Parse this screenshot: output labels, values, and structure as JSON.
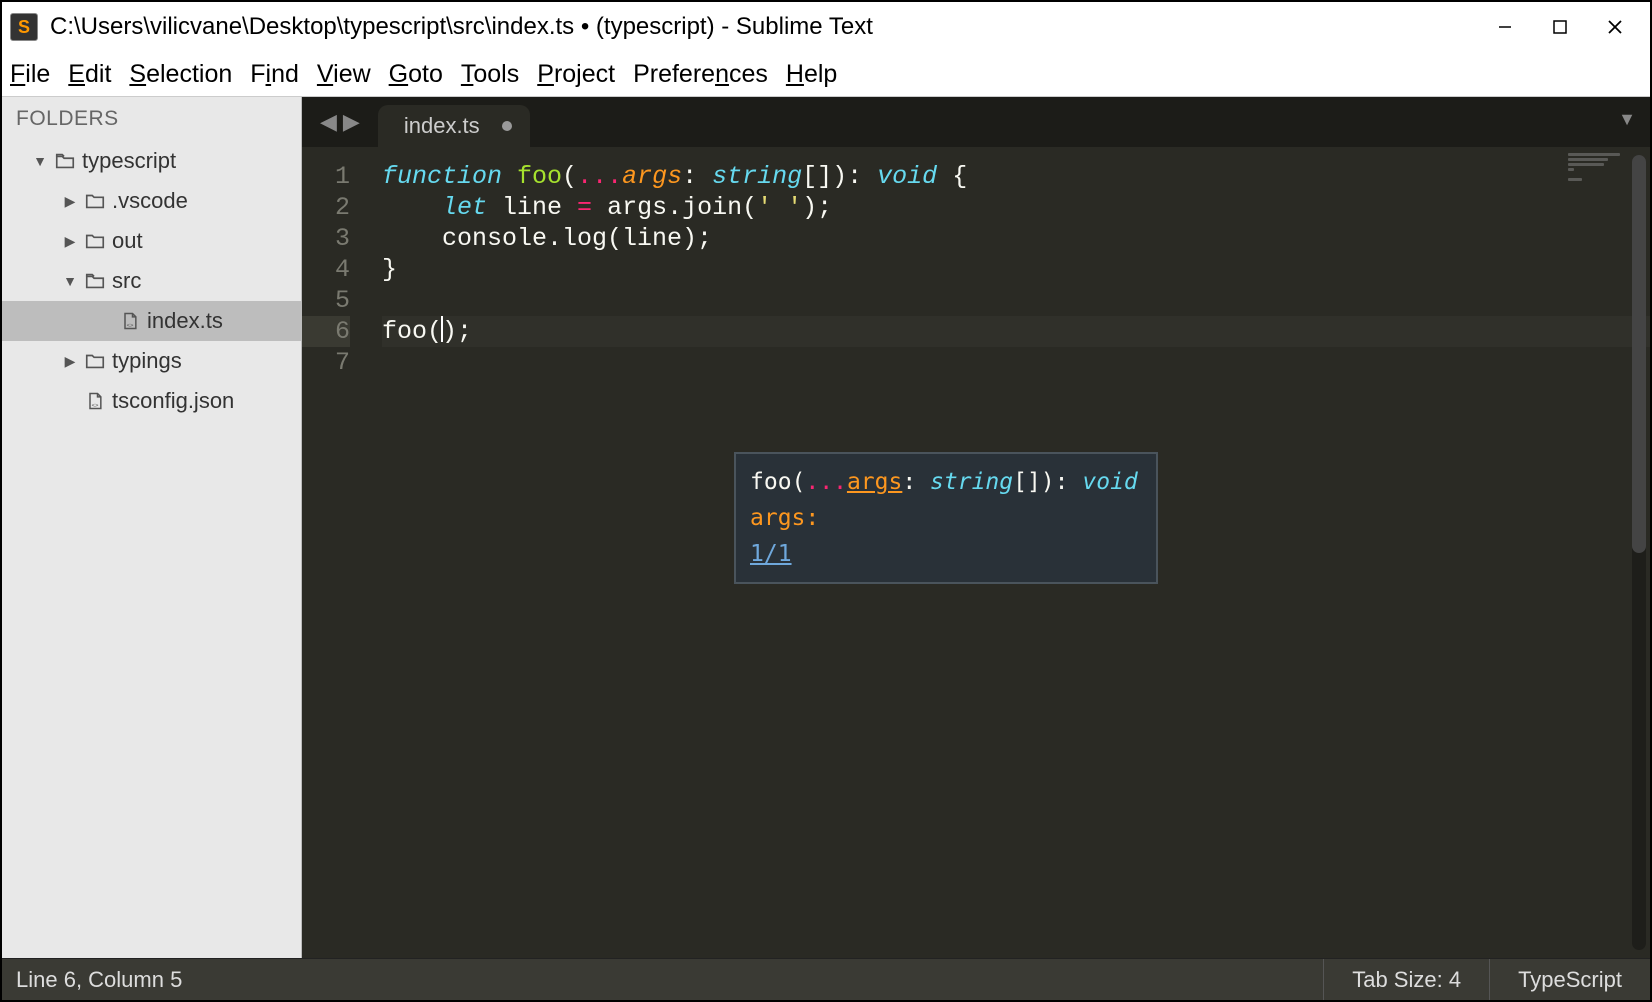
{
  "window": {
    "title": "C:\\Users\\vilicvane\\Desktop\\typescript\\src\\index.ts • (typescript) - Sublime Text"
  },
  "menu": {
    "items": [
      "File",
      "Edit",
      "Selection",
      "Find",
      "View",
      "Goto",
      "Tools",
      "Project",
      "Preferences",
      "Help"
    ]
  },
  "sidebar": {
    "header": "FOLDERS",
    "tree": [
      {
        "label": "typescript",
        "type": "folder-open",
        "depth": 1,
        "expanded": true
      },
      {
        "label": ".vscode",
        "type": "folder",
        "depth": 2,
        "expanded": false
      },
      {
        "label": "out",
        "type": "folder",
        "depth": 2,
        "expanded": false
      },
      {
        "label": "src",
        "type": "folder-open",
        "depth": 2,
        "expanded": true
      },
      {
        "label": "index.ts",
        "type": "file-code",
        "depth": 3,
        "selected": true
      },
      {
        "label": "typings",
        "type": "folder",
        "depth": 2,
        "expanded": false
      },
      {
        "label": "tsconfig.json",
        "type": "file-code",
        "depth": 2
      }
    ]
  },
  "tabs": {
    "active": {
      "label": "index.ts",
      "dirty": true
    }
  },
  "code": {
    "lines": [
      [
        {
          "t": "function ",
          "c": "kw"
        },
        {
          "t": "foo",
          "c": "fn"
        },
        {
          "t": "(",
          "c": "pln"
        },
        {
          "t": "...",
          "c": "op"
        },
        {
          "t": "args",
          "c": "param"
        },
        {
          "t": ": ",
          "c": "pln"
        },
        {
          "t": "string",
          "c": "type"
        },
        {
          "t": "[]",
          "c": "pln"
        },
        {
          "t": ")",
          "c": "pln"
        },
        {
          "t": ": ",
          "c": "pln"
        },
        {
          "t": "void ",
          "c": "type"
        },
        {
          "t": "{",
          "c": "pln"
        }
      ],
      [
        {
          "t": "    ",
          "c": "pln"
        },
        {
          "t": "let ",
          "c": "kw2"
        },
        {
          "t": "line ",
          "c": "pln"
        },
        {
          "t": "= ",
          "c": "op"
        },
        {
          "t": "args.join(",
          "c": "pln"
        },
        {
          "t": "' '",
          "c": "str"
        },
        {
          "t": ");",
          "c": "pln"
        }
      ],
      [
        {
          "t": "    console.log(line);",
          "c": "pln"
        }
      ],
      [
        {
          "t": "}",
          "c": "pln"
        }
      ],
      [
        {
          "t": "",
          "c": "pln"
        }
      ],
      [
        {
          "t": "foo(",
          "c": "pln"
        },
        {
          "caret": true
        },
        {
          "t": ");",
          "c": "pln"
        }
      ],
      [
        {
          "t": "",
          "c": "pln"
        }
      ]
    ],
    "active_line_index": 5
  },
  "signature_help": {
    "line1_prefix": "foo(",
    "line1_dots": "...",
    "line1_args": "args",
    "line1_mid": ": ",
    "line1_type": "string",
    "line1_brackets": "[]",
    "line1_after": "): ",
    "line1_void": "void",
    "line2": "args:",
    "counter": "1/1"
  },
  "status": {
    "position": "Line 6, Column 5",
    "tab_size": "Tab Size: 4",
    "language": "TypeScript"
  }
}
